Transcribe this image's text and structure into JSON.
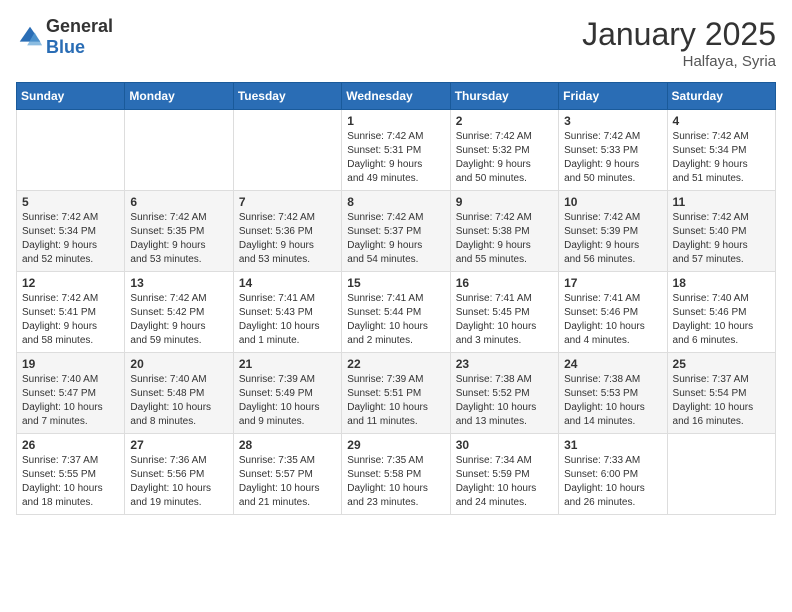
{
  "logo": {
    "general": "General",
    "blue": "Blue"
  },
  "header": {
    "month": "January 2025",
    "location": "Halfaya, Syria"
  },
  "weekdays": [
    "Sunday",
    "Monday",
    "Tuesday",
    "Wednesday",
    "Thursday",
    "Friday",
    "Saturday"
  ],
  "weeks": [
    [
      {
        "day": "",
        "info": ""
      },
      {
        "day": "",
        "info": ""
      },
      {
        "day": "",
        "info": ""
      },
      {
        "day": "1",
        "info": "Sunrise: 7:42 AM\nSunset: 5:31 PM\nDaylight: 9 hours\nand 49 minutes."
      },
      {
        "day": "2",
        "info": "Sunrise: 7:42 AM\nSunset: 5:32 PM\nDaylight: 9 hours\nand 50 minutes."
      },
      {
        "day": "3",
        "info": "Sunrise: 7:42 AM\nSunset: 5:33 PM\nDaylight: 9 hours\nand 50 minutes."
      },
      {
        "day": "4",
        "info": "Sunrise: 7:42 AM\nSunset: 5:34 PM\nDaylight: 9 hours\nand 51 minutes."
      }
    ],
    [
      {
        "day": "5",
        "info": "Sunrise: 7:42 AM\nSunset: 5:34 PM\nDaylight: 9 hours\nand 52 minutes."
      },
      {
        "day": "6",
        "info": "Sunrise: 7:42 AM\nSunset: 5:35 PM\nDaylight: 9 hours\nand 53 minutes."
      },
      {
        "day": "7",
        "info": "Sunrise: 7:42 AM\nSunset: 5:36 PM\nDaylight: 9 hours\nand 53 minutes."
      },
      {
        "day": "8",
        "info": "Sunrise: 7:42 AM\nSunset: 5:37 PM\nDaylight: 9 hours\nand 54 minutes."
      },
      {
        "day": "9",
        "info": "Sunrise: 7:42 AM\nSunset: 5:38 PM\nDaylight: 9 hours\nand 55 minutes."
      },
      {
        "day": "10",
        "info": "Sunrise: 7:42 AM\nSunset: 5:39 PM\nDaylight: 9 hours\nand 56 minutes."
      },
      {
        "day": "11",
        "info": "Sunrise: 7:42 AM\nSunset: 5:40 PM\nDaylight: 9 hours\nand 57 minutes."
      }
    ],
    [
      {
        "day": "12",
        "info": "Sunrise: 7:42 AM\nSunset: 5:41 PM\nDaylight: 9 hours\nand 58 minutes."
      },
      {
        "day": "13",
        "info": "Sunrise: 7:42 AM\nSunset: 5:42 PM\nDaylight: 9 hours\nand 59 minutes."
      },
      {
        "day": "14",
        "info": "Sunrise: 7:41 AM\nSunset: 5:43 PM\nDaylight: 10 hours\nand 1 minute."
      },
      {
        "day": "15",
        "info": "Sunrise: 7:41 AM\nSunset: 5:44 PM\nDaylight: 10 hours\nand 2 minutes."
      },
      {
        "day": "16",
        "info": "Sunrise: 7:41 AM\nSunset: 5:45 PM\nDaylight: 10 hours\nand 3 minutes."
      },
      {
        "day": "17",
        "info": "Sunrise: 7:41 AM\nSunset: 5:46 PM\nDaylight: 10 hours\nand 4 minutes."
      },
      {
        "day": "18",
        "info": "Sunrise: 7:40 AM\nSunset: 5:46 PM\nDaylight: 10 hours\nand 6 minutes."
      }
    ],
    [
      {
        "day": "19",
        "info": "Sunrise: 7:40 AM\nSunset: 5:47 PM\nDaylight: 10 hours\nand 7 minutes."
      },
      {
        "day": "20",
        "info": "Sunrise: 7:40 AM\nSunset: 5:48 PM\nDaylight: 10 hours\nand 8 minutes."
      },
      {
        "day": "21",
        "info": "Sunrise: 7:39 AM\nSunset: 5:49 PM\nDaylight: 10 hours\nand 9 minutes."
      },
      {
        "day": "22",
        "info": "Sunrise: 7:39 AM\nSunset: 5:51 PM\nDaylight: 10 hours\nand 11 minutes."
      },
      {
        "day": "23",
        "info": "Sunrise: 7:38 AM\nSunset: 5:52 PM\nDaylight: 10 hours\nand 13 minutes."
      },
      {
        "day": "24",
        "info": "Sunrise: 7:38 AM\nSunset: 5:53 PM\nDaylight: 10 hours\nand 14 minutes."
      },
      {
        "day": "25",
        "info": "Sunrise: 7:37 AM\nSunset: 5:54 PM\nDaylight: 10 hours\nand 16 minutes."
      }
    ],
    [
      {
        "day": "26",
        "info": "Sunrise: 7:37 AM\nSunset: 5:55 PM\nDaylight: 10 hours\nand 18 minutes."
      },
      {
        "day": "27",
        "info": "Sunrise: 7:36 AM\nSunset: 5:56 PM\nDaylight: 10 hours\nand 19 minutes."
      },
      {
        "day": "28",
        "info": "Sunrise: 7:35 AM\nSunset: 5:57 PM\nDaylight: 10 hours\nand 21 minutes."
      },
      {
        "day": "29",
        "info": "Sunrise: 7:35 AM\nSunset: 5:58 PM\nDaylight: 10 hours\nand 23 minutes."
      },
      {
        "day": "30",
        "info": "Sunrise: 7:34 AM\nSunset: 5:59 PM\nDaylight: 10 hours\nand 24 minutes."
      },
      {
        "day": "31",
        "info": "Sunrise: 7:33 AM\nSunset: 6:00 PM\nDaylight: 10 hours\nand 26 minutes."
      },
      {
        "day": "",
        "info": ""
      }
    ]
  ]
}
